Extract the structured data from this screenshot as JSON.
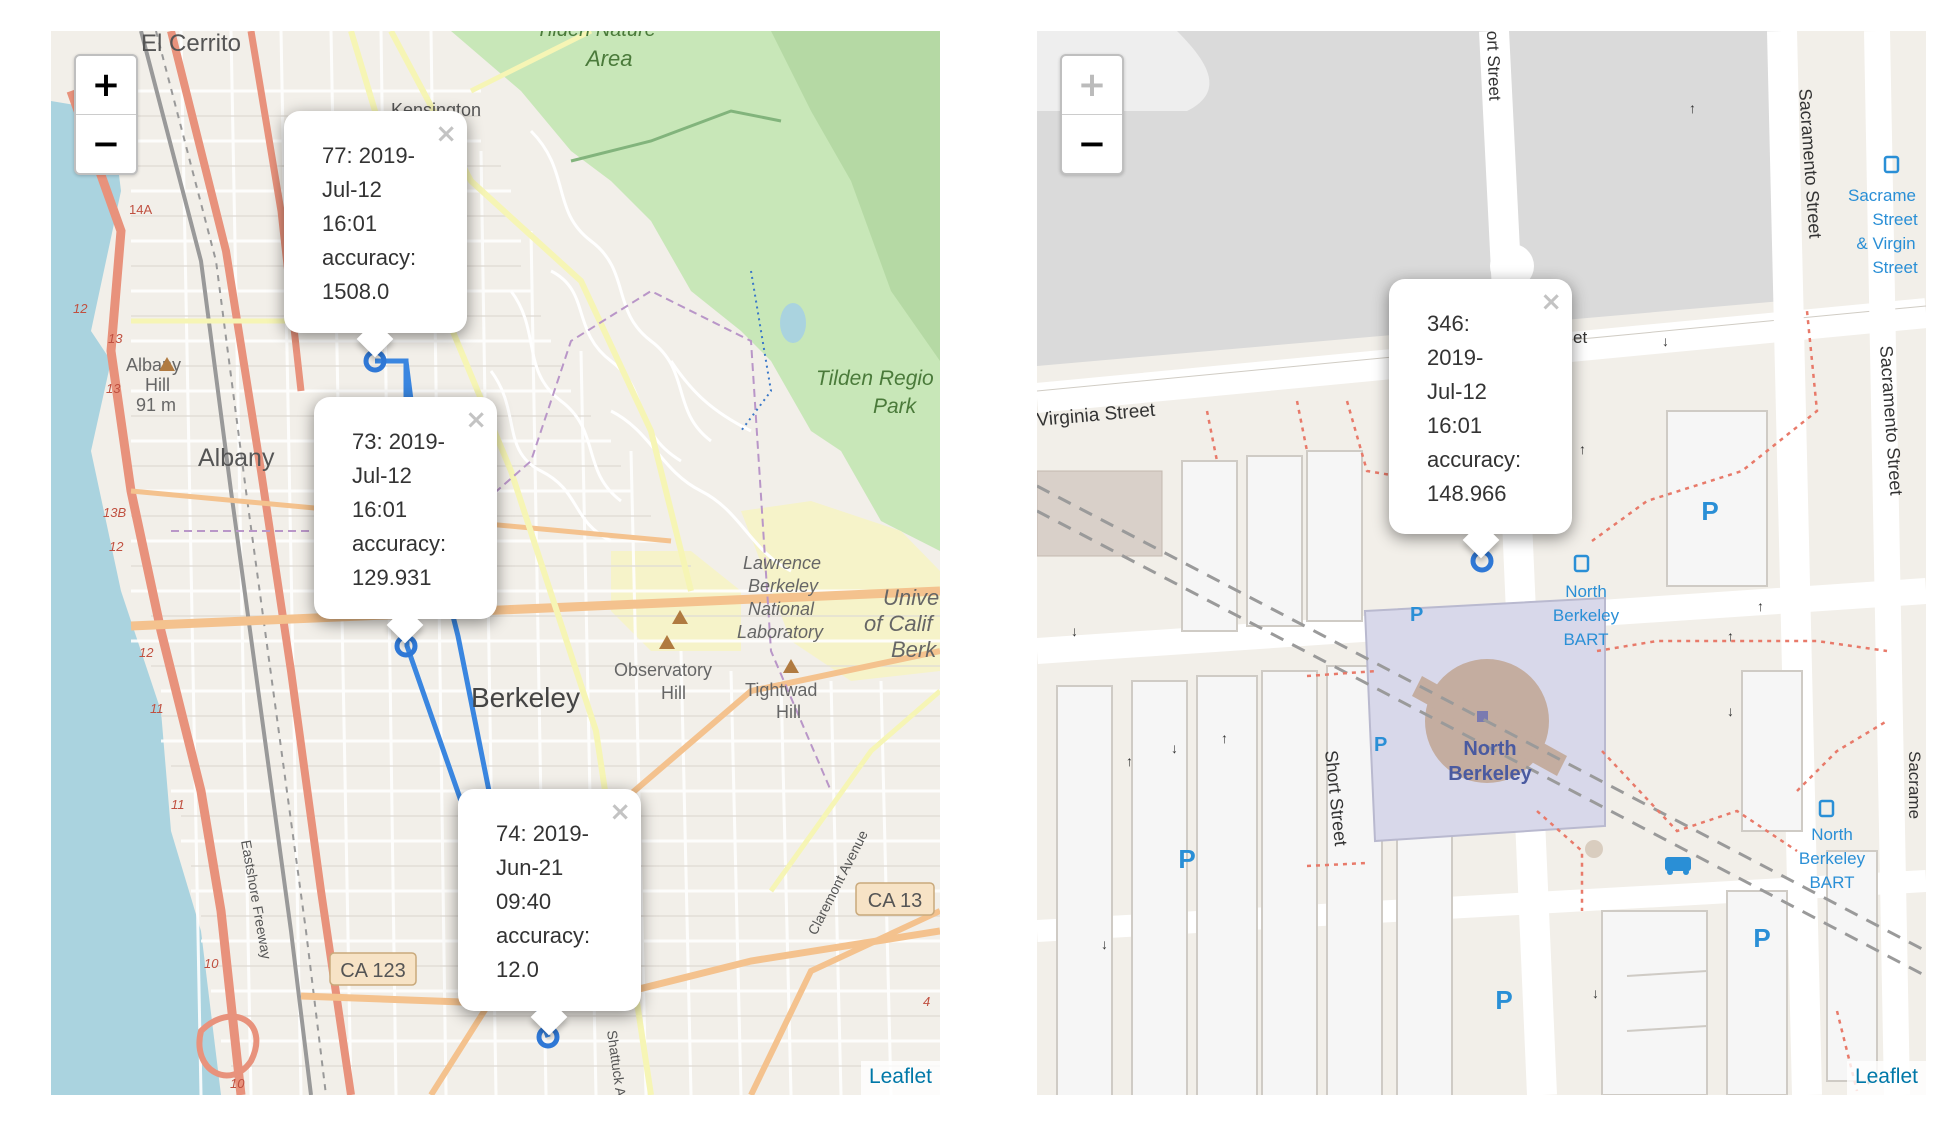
{
  "maps": [
    {
      "zoom_in": "+",
      "zoom_out": "−",
      "attribution": "Leaflet",
      "labels": {
        "el_cerrito": "El Cerrito",
        "tilden_nature_top": "Tilden Nature",
        "area": "Area",
        "kensington": "Kensington",
        "tilden_regional": "Tilden Regio",
        "park": "Park",
        "albany_hill": "Albany",
        "albany_hill_2": "Hill",
        "albany_hill_elev": "91 m",
        "albany": "Albany",
        "lawrence_1": "Lawrence",
        "lawrence_2": "Berkeley",
        "lawrence_3": "National",
        "lawrence_4": "Laboratory",
        "univ_1": "Unive",
        "univ_2": "of Calif",
        "univ_3": "Berk",
        "observatory_1": "Observatory",
        "observatory_2": "Hill",
        "tightwad_1": "Tightwad",
        "tightwad_2": "Hill",
        "berkeley": "Berkeley",
        "ca13": "CA 13",
        "ca123": "CA 123",
        "claremont": "Claremont Avenue",
        "eastshore": "Eastshore Freeway",
        "shattuck": "Shattuck Ave",
        "r14a": "14A",
        "r12a": "12",
        "r13a": "13",
        "r13b": "13",
        "r13bb": "13B",
        "r12b": "12",
        "r12c": "12",
        "r11": "11",
        "r11b": "11",
        "r10": "10",
        "r10b": "10",
        "r4": "4"
      },
      "popups": [
        {
          "lines": [
            "77: 2019-",
            "Jul-12",
            "16:01",
            "accuracy:",
            "1508.0"
          ],
          "close": "×"
        },
        {
          "lines": [
            "73: 2019-",
            "Jul-12",
            "16:01",
            "accuracy:",
            "129.931"
          ],
          "close": "×"
        },
        {
          "lines": [
            "74: 2019-",
            "Jun-21",
            "09:40",
            "accuracy:",
            "12.0"
          ],
          "close": "×"
        }
      ]
    },
    {
      "zoom_in": "+",
      "zoom_out": "−",
      "attribution": "Leaflet",
      "labels": {
        "short_street_top": "ort Street",
        "sacramento_1": "Sacramento Street",
        "sacramento_2": "Sacramento Street",
        "virginia": "Virginia Street",
        "short_street": "Short Street",
        "stop_1": "Sacrame",
        "stop_2": "Street",
        "stop_3": "& Virgin",
        "stop_4": "Street",
        "nb_bart_1": "North",
        "nb_bart_2": "Berkeley",
        "nb_bart_3": "BART",
        "nb_station_1": "North",
        "nb_station_2": "Berkeley",
        "nb_bart_b1": "North",
        "nb_bart_b2": "Berkeley",
        "nb_bart_b3": "BART",
        "parking": "P",
        "street_et": "et",
        "sacramento_bottom": "Sacrame"
      },
      "popups": [
        {
          "lines": [
            "346:",
            "2019-",
            "Jul-12",
            "16:01",
            "accuracy:",
            "148.966"
          ],
          "close": "×"
        }
      ]
    }
  ],
  "colors": {
    "route": "#3a86e0",
    "park_green": "#c8e7b8",
    "water": "#aad3df",
    "motorway": "#e8927c",
    "primary_road": "#f4c28e",
    "secondary_road": "#f6f5b5",
    "land": "#f2efe9",
    "station_area": "#d8d8ea",
    "link": "#0078a8"
  }
}
